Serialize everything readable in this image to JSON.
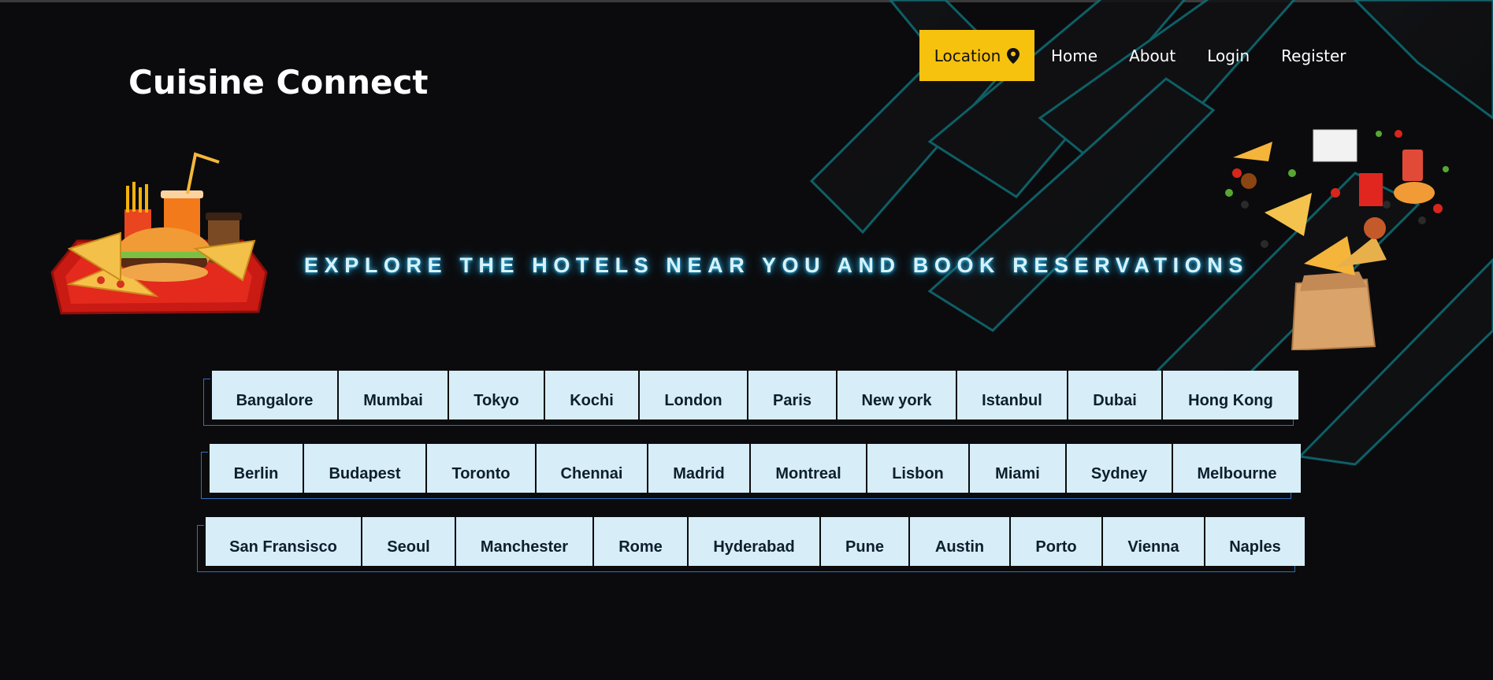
{
  "brand": {
    "title": "Cuisine Connect"
  },
  "nav": {
    "location_label": "Location",
    "links": [
      "Home",
      "About",
      "Login",
      "Register"
    ]
  },
  "hero": {
    "headline": "EXPLORE THE HOTELS NEAR YOU AND BOOK RESERVATIONS"
  },
  "colors": {
    "accent": "#f7c20d",
    "button_bg": "#d7edf8",
    "glow": "#2fb4e6"
  },
  "cities": {
    "row1": [
      "Bangalore",
      "Mumbai",
      "Tokyo",
      "Kochi",
      "London",
      "Paris",
      "New york",
      "Istanbul",
      "Dubai",
      "Hong Kong"
    ],
    "row2": [
      "Berlin",
      "Budapest",
      "Toronto",
      "Chennai",
      "Madrid",
      "Montreal",
      "Lisbon",
      "Miami",
      "Sydney",
      "Melbourne"
    ],
    "row3": [
      "San Fransisco",
      "Seoul",
      "Manchester",
      "Rome",
      "Hyderabad",
      "Pune",
      "Austin",
      "Porto",
      "Vienna",
      "Naples"
    ]
  }
}
